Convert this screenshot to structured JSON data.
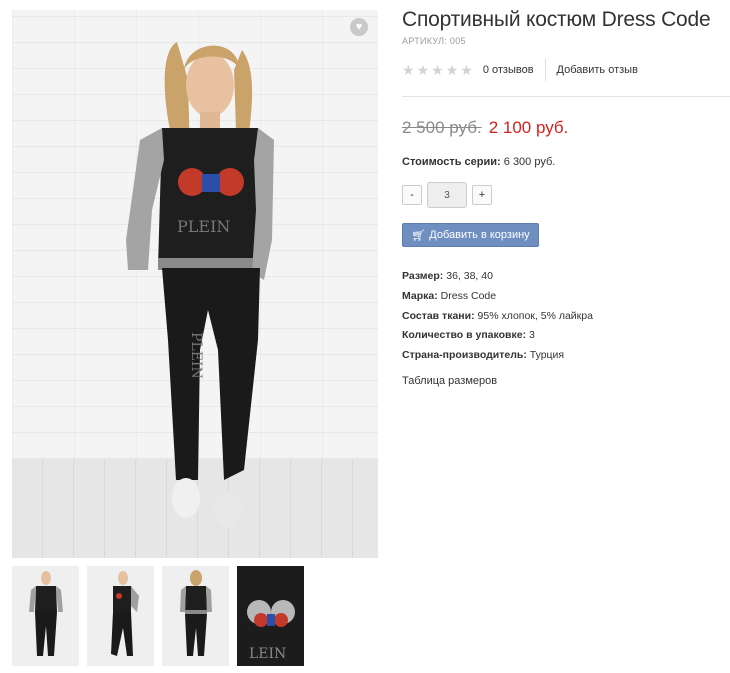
{
  "product": {
    "title": "Спортивный костюм Dress Code",
    "sku": "АРТИКУЛ: 005"
  },
  "rating": {
    "stars": 0,
    "max_stars": 5,
    "reviews_label": "0 отзывов",
    "add_review_label": "Добавить отзыв"
  },
  "price": {
    "old": "2 500 руб.",
    "new": "2 100 руб."
  },
  "series": {
    "label": "Стоимость серии:",
    "value": "6 300 руб."
  },
  "quantity": {
    "minus_label": "-",
    "value": "3",
    "plus_label": "+"
  },
  "cart": {
    "button_label": "Добавить в корзину",
    "icon": "cart-icon"
  },
  "attributes": [
    {
      "label": "Размер:",
      "value": "36, 38, 40"
    },
    {
      "label": "Марка:",
      "value": "Dress Code"
    },
    {
      "label": "Состав ткани:",
      "value": "95% хлопок, 5% лайкра"
    },
    {
      "label": "Количество в упаковке:",
      "value": "3"
    },
    {
      "label": "Страна-производитель:",
      "value": "Турция"
    }
  ],
  "size_table_label": "Таблица размеров",
  "gallery": {
    "wishlist_icon": "heart-icon",
    "thumbnails": [
      "front-view",
      "side-view",
      "back-view",
      "print-detail"
    ]
  },
  "colors": {
    "price_new": "#d62020",
    "cart_button": "#6f8fc1"
  }
}
